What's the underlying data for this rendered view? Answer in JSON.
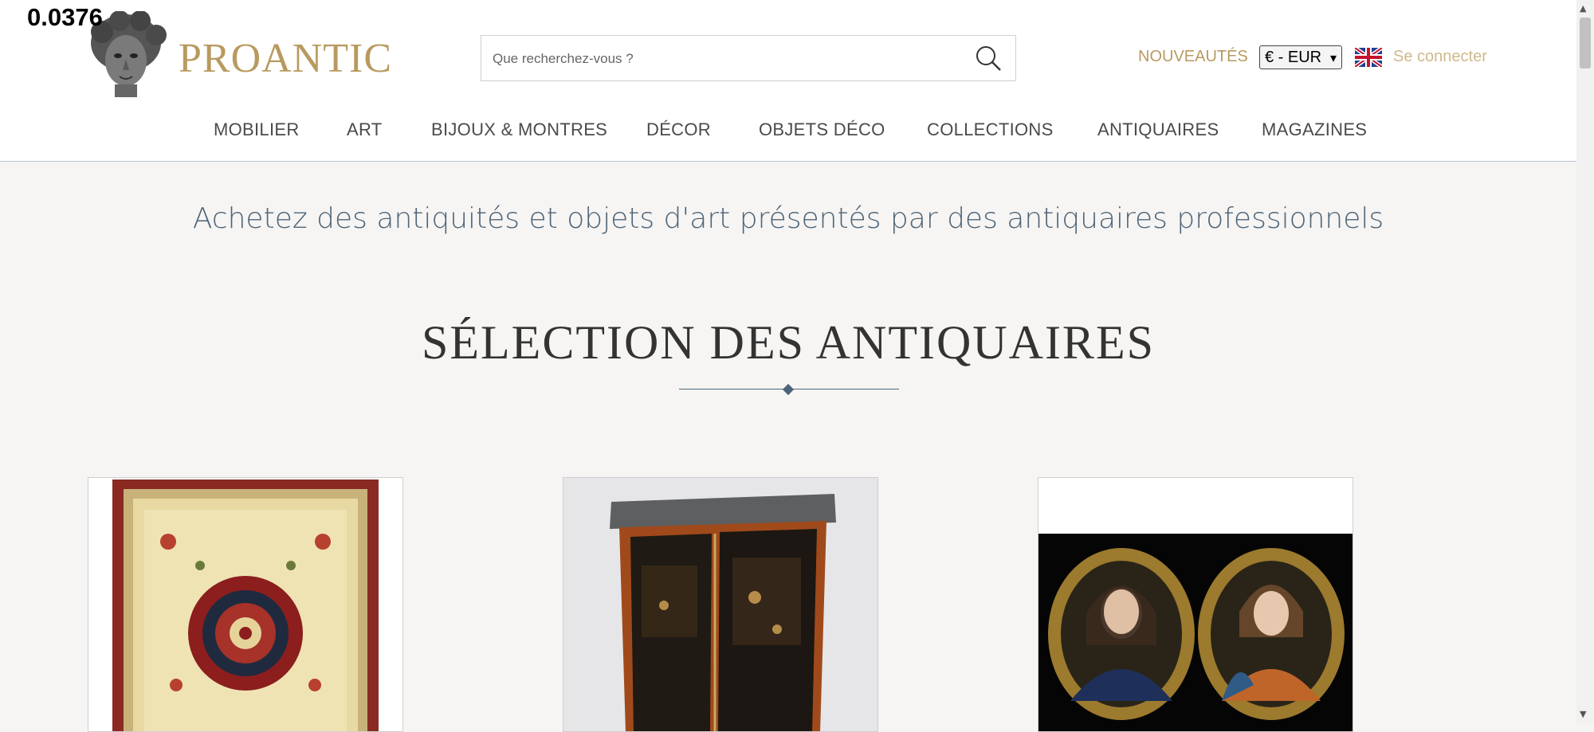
{
  "overlay_number": "0.0376",
  "header": {
    "brand": "PROANTIC",
    "search_placeholder": "Que recherchez-vous ?",
    "nouveautes": "NOUVEAUTÉS",
    "currency": "€ - EUR",
    "login": "Se connecter"
  },
  "nav": {
    "items": [
      {
        "label": "MOBILIER"
      },
      {
        "label": "ART"
      },
      {
        "label": "BIJOUX & MONTRES"
      },
      {
        "label": "DÉCOR"
      },
      {
        "label": "OBJETS DÉCO"
      },
      {
        "label": "COLLECTIONS"
      },
      {
        "label": "ANTIQUAIRES"
      },
      {
        "label": "MAGAZINES"
      }
    ]
  },
  "main": {
    "tagline": "Achetez des antiquités et objets d'art présentés par des antiquaires professionnels",
    "section_title": "SÉLECTION DES ANTIQUAIRES"
  },
  "colors": {
    "brand_gold": "#b89a5f",
    "accent_blue": "#4e6478",
    "background": "#f6f5f3"
  },
  "icons": [
    "search-icon",
    "uk-flag-icon",
    "logo-head-icon"
  ]
}
